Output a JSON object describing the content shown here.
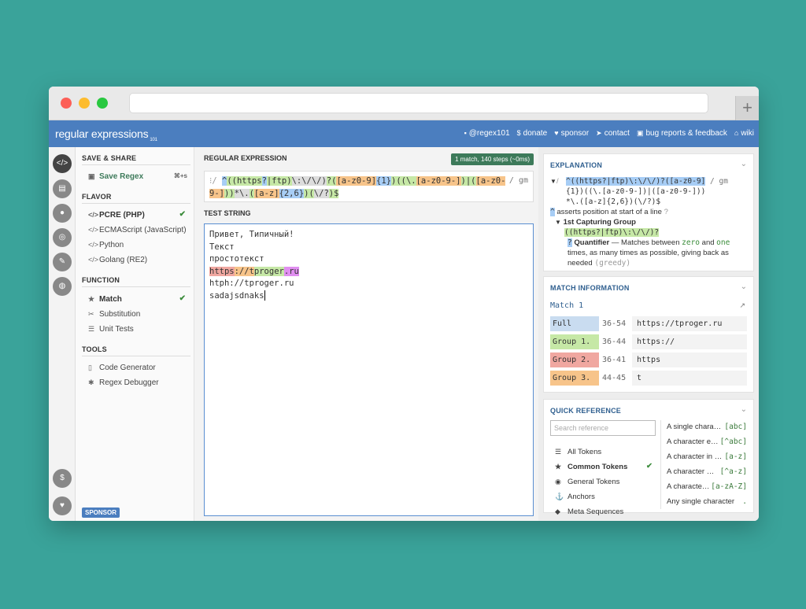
{
  "navbar": {
    "brand": "regular expressions",
    "brand_suffix": "101",
    "links": [
      {
        "icon": "twitter-icon",
        "glyph": "▪",
        "label": "@regex101"
      },
      {
        "icon": "dollar-icon",
        "glyph": "$",
        "label": "donate"
      },
      {
        "icon": "heart-icon",
        "glyph": "♥",
        "label": "sponsor"
      },
      {
        "icon": "send-icon",
        "glyph": "➤",
        "label": "contact"
      },
      {
        "icon": "bug-icon",
        "glyph": "▣",
        "label": "bug reports & feedback"
      },
      {
        "icon": "bank-icon",
        "glyph": "⌂",
        "label": "wiki"
      }
    ]
  },
  "sidebar": {
    "save_share_title": "SAVE & SHARE",
    "save_regex": "Save Regex",
    "save_shortcut": "⌘+s",
    "flavor_title": "FLAVOR",
    "flavors": [
      "PCRE (PHP)",
      "ECMAScript (JavaScript)",
      "Python",
      "Golang (RE2)"
    ],
    "function_title": "FUNCTION",
    "functions": [
      "Match",
      "Substitution",
      "Unit Tests"
    ],
    "tools_title": "TOOLS",
    "tools": [
      "Code Generator",
      "Regex Debugger"
    ],
    "sponsor_tag": "SPONSOR"
  },
  "regex": {
    "title": "REGULAR EXPRESSION",
    "badge": "1 match, 140 steps (~0ms)",
    "open_delim": "⁝/",
    "flags": "/ gm",
    "parts": [
      {
        "t": "^",
        "c": "hl-blue"
      },
      {
        "t": "((https",
        "c": "hl-green"
      },
      {
        "t": "?",
        "c": "hl-blue"
      },
      {
        "t": "|ftp)",
        "c": "hl-green"
      },
      {
        "t": "\\:\\/\\/)",
        "c": "hl-gray"
      },
      {
        "t": "?(",
        "c": "hl-green"
      },
      {
        "t": "[a-z0-9]",
        "c": "hl-orange"
      },
      {
        "t": "{1}",
        "c": "hl-blue"
      },
      {
        "t": ")((\\.",
        "c": "hl-green"
      },
      {
        "t": "[a-z0-9-]",
        "c": "hl-orange"
      },
      {
        "t": ")|",
        "c": "hl-green"
      },
      {
        "t": "(",
        "c": "hl-green"
      },
      {
        "t": "[a-z0-9-]",
        "c": "hl-orange"
      },
      {
        "t": "))",
        "c": "hl-green"
      },
      {
        "t": "*\\.",
        "c": "hl-gray"
      },
      {
        "t": "(",
        "c": "hl-green"
      },
      {
        "t": "[a-z]",
        "c": "hl-orange"
      },
      {
        "t": "{2,6}",
        "c": "hl-blue"
      },
      {
        "t": ")(",
        "c": "hl-green"
      },
      {
        "t": "\\/?",
        "c": "hl-gray"
      },
      {
        "t": ")$",
        "c": "hl-green"
      }
    ]
  },
  "test": {
    "title": "TEST STRING",
    "lines": [
      "Привет, Типичный!",
      "Текст",
      "простотекст",
      "",
      "htph://tproger.ru",
      "sadajsdnaks"
    ],
    "match_line": [
      {
        "t": "https",
        "c": "m-red"
      },
      {
        "t": "://",
        "c": "m-orange"
      },
      {
        "t": "t",
        "c": "m-orange"
      },
      {
        "t": "proger",
        "c": "m-green"
      },
      {
        "t": ".ru",
        "c": "m-purple"
      }
    ]
  },
  "explanation": {
    "title": "EXPLANATION",
    "regex_line1": "^((https?|ftp)\\:\\/\\/)?([a-z0-9]",
    "regex_line2": "{1})((\\.[a-z0-9-])|([a-z0-9-]))",
    "regex_line3": "*\\.([a-z]{2,6})(\\/?)$",
    "flags": "/ gm",
    "anchor_token": "^",
    "anchor_text": "asserts position at start of a line",
    "group_title": "1st Capturing Group",
    "group_regex": "((https?|ftp)\\:\\/\\/)?",
    "quant_token": "?",
    "quant_label": "Quantifier",
    "quant_text_a": "— Matches between",
    "quant_zero": "zero",
    "quant_and": "and",
    "quant_one": "one",
    "quant_text_b": "times, as many times as possible, giving back as needed",
    "quant_greedy": "(greedy)"
  },
  "match_info": {
    "title": "MATCH INFORMATION",
    "match_label": "Match 1",
    "rows": [
      {
        "label": "Full match",
        "range": "36-54",
        "value": "https://tproger.ru",
        "color": "#c9dcf0"
      },
      {
        "label": "Group 1.",
        "range": "36-44",
        "value": "https://",
        "color": "#c6e8a6"
      },
      {
        "label": "Group 2.",
        "range": "36-41",
        "value": "https",
        "color": "#f0a7a0"
      },
      {
        "label": "Group 3.",
        "range": "44-45",
        "value": "t",
        "color": "#f7c48a"
      }
    ]
  },
  "quick_ref": {
    "title": "QUICK REFERENCE",
    "search_placeholder": "Search reference",
    "categories": [
      {
        "icon": "all-tokens-icon",
        "glyph": "☰",
        "label": "All Tokens"
      },
      {
        "icon": "star-icon",
        "glyph": "★",
        "label": "Common Tokens",
        "bold": true,
        "checked": true
      },
      {
        "icon": "target-icon",
        "glyph": "◉",
        "label": "General Tokens"
      },
      {
        "icon": "anchor-icon",
        "glyph": "⚓",
        "label": "Anchors"
      },
      {
        "icon": "meta-icon",
        "glyph": "◆",
        "label": "Meta Sequences"
      }
    ],
    "tokens": [
      {
        "label": "A single chara…",
        "token": "[abc]"
      },
      {
        "label": "A character e…",
        "token": "[^abc]"
      },
      {
        "label": "A character in …",
        "token": "[a-z]"
      },
      {
        "label": "A character …",
        "token": "[^a-z]"
      },
      {
        "label": "A characte…",
        "token": "[a-zA-Z]"
      },
      {
        "label": "Any single character",
        "token": "."
      }
    ]
  }
}
